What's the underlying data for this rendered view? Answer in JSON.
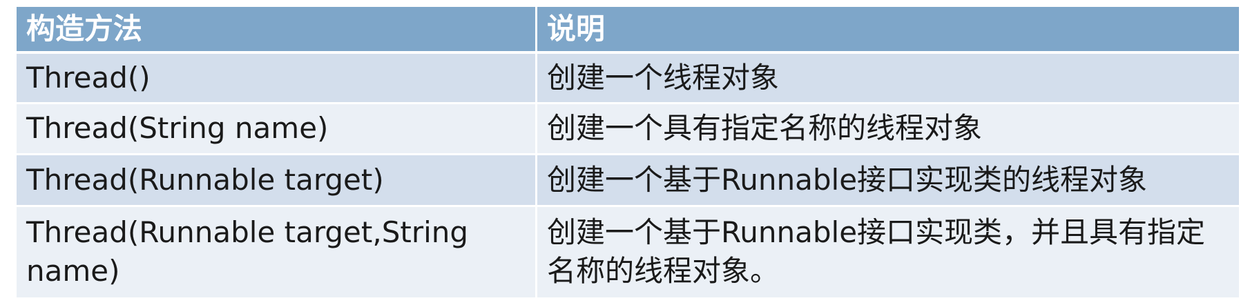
{
  "table": {
    "headers": [
      "构造方法",
      "说明"
    ],
    "rows": [
      {
        "method": "Thread()",
        "description": "创建一个线程对象"
      },
      {
        "method": "Thread(String name)",
        "description": "创建一个具有指定名称的线程对象"
      },
      {
        "method": "Thread(Runnable target)",
        "description": "创建一个基于Runnable接口实现类的线程对象"
      },
      {
        "method": "Thread(Runnable target,String name)",
        "description": "创建一个基于Runnable接口实现类，并且具有指定名称的线程对象。"
      }
    ]
  },
  "colors": {
    "header_bg": "#7ea6c9",
    "row_odd_bg": "#d3deec",
    "row_even_bg": "#ebf0f6",
    "header_text": "#ffffff",
    "body_text": "#1a1a1a"
  }
}
